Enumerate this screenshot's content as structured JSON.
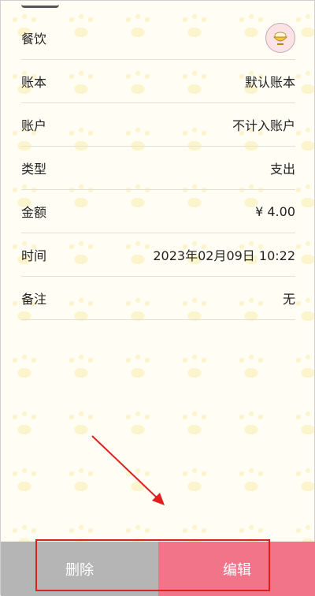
{
  "detail": {
    "category": {
      "label": "餐饮",
      "icon": "rice-bowl-icon"
    },
    "rows": [
      {
        "label": "账本",
        "value": "默认账本"
      },
      {
        "label": "账户",
        "value": "不计入账户"
      },
      {
        "label": "类型",
        "value": "支出"
      },
      {
        "label": "金额",
        "value": "¥ 4.00"
      },
      {
        "label": "时间",
        "value": "2023年02月09日 10:22"
      },
      {
        "label": "备注",
        "value": "无"
      }
    ]
  },
  "actions": {
    "delete_label": "删除",
    "edit_label": "编辑"
  },
  "colors": {
    "delete_bg": "#b5b5b5",
    "edit_bg": "#f27489",
    "annotation": "#e02020"
  }
}
